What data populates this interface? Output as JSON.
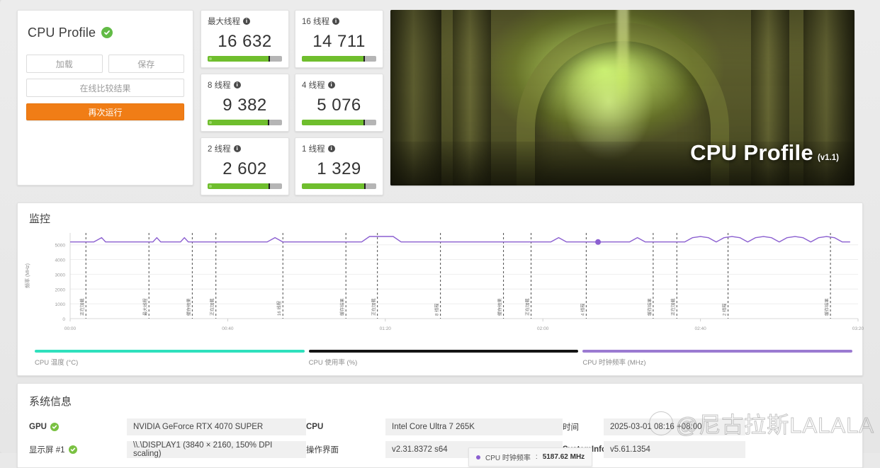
{
  "left_panel": {
    "title": "CPU Profile",
    "verified_icon": "check-badge-icon",
    "load_button": "加载",
    "save_button": "保存",
    "compare_button": "在线比较结果",
    "rerun_button": "再次运行"
  },
  "scores": [
    {
      "label": "最大线程",
      "value": "16 632",
      "fill_pct": 82,
      "tick_pct": 82
    },
    {
      "label": "16 线程",
      "value": "14 711",
      "fill_pct": 83,
      "tick_pct": 83
    },
    {
      "label": "8 线程",
      "value": "9 382",
      "fill_pct": 81,
      "tick_pct": 81
    },
    {
      "label": "4 线程",
      "value": "5 076",
      "fill_pct": 83,
      "tick_pct": 83
    },
    {
      "label": "2 线程",
      "value": "2 602",
      "fill_pct": 82,
      "tick_pct": 82
    },
    {
      "label": "1 线程",
      "value": "1 329",
      "fill_pct": 84,
      "tick_pct": 84
    }
  ],
  "hero": {
    "title": "CPU Profile",
    "version": "(v1.1)"
  },
  "monitoring": {
    "title": "监控",
    "tooltip": {
      "series": "CPU 时钟频率",
      "separator": " : ",
      "value": "5187.62 MHz"
    },
    "legend": [
      {
        "label": "CPU 温度 (°C)",
        "color": "#2fe0bd"
      },
      {
        "label": "CPU 使用率 (%)",
        "color": "#141414"
      },
      {
        "label": "CPU 时钟频率 (MHz)",
        "color": "#9b7ad1"
      }
    ]
  },
  "chart_data": {
    "type": "line",
    "title": "监控",
    "xlabel": "",
    "ylabel": "频率 (MHz)",
    "ylim": [
      0,
      5800
    ],
    "yticks": [
      0,
      1000,
      2000,
      3000,
      4000,
      5000
    ],
    "xlim": [
      0,
      200
    ],
    "xticks": [
      0,
      40,
      80,
      120,
      160,
      200
    ],
    "xtick_labels": [
      "00:00",
      "00:40",
      "01:20",
      "02:00",
      "02:40",
      "03:20"
    ],
    "grid": true,
    "legend_position": "bottom",
    "series": [
      {
        "name": "CPU 时钟频率 (MHz)",
        "color": "#8b5fd0",
        "unit": "MHz",
        "x": [
          0,
          3,
          6,
          8,
          9,
          11,
          13,
          16,
          19,
          21,
          22,
          23,
          25,
          27,
          28,
          29,
          30,
          32,
          34,
          36,
          38,
          39,
          40,
          42,
          44,
          46,
          48,
          50,
          52,
          54,
          56,
          58,
          60,
          62,
          64,
          66,
          68,
          70,
          72,
          74,
          76,
          78,
          80,
          82,
          84,
          86,
          88,
          90,
          92,
          94,
          96,
          98,
          100,
          102,
          104,
          106,
          108,
          110,
          112,
          114,
          116,
          118,
          120,
          122,
          124,
          126,
          128,
          130,
          132,
          134,
          136,
          138,
          140,
          142,
          144,
          146,
          148,
          150,
          152,
          154,
          156,
          158,
          160,
          162,
          164,
          166,
          168,
          170,
          172,
          174,
          176,
          178,
          180,
          182,
          184,
          186,
          188,
          190,
          192,
          194,
          196,
          198
        ],
        "y": [
          5190,
          5190,
          5190,
          5480,
          5190,
          5190,
          5190,
          5190,
          5190,
          5190,
          5480,
          5190,
          5190,
          5190,
          5190,
          5480,
          5190,
          5190,
          5190,
          5190,
          5190,
          5190,
          5190,
          5190,
          5190,
          5190,
          5190,
          5190,
          5480,
          5190,
          5190,
          5190,
          5190,
          5190,
          5190,
          5190,
          5190,
          5190,
          5190,
          5190,
          5560,
          5560,
          5560,
          5560,
          5190,
          5190,
          5190,
          5190,
          5190,
          5190,
          5190,
          5190,
          5190,
          5190,
          5190,
          5190,
          5190,
          5190,
          5190,
          5190,
          5190,
          5190,
          5190,
          5190,
          5480,
          5190,
          5190,
          5190,
          5190,
          5188,
          5190,
          5190,
          5190,
          5190,
          5480,
          5190,
          5190,
          5190,
          5190,
          5190,
          5190,
          5480,
          5560,
          5480,
          5190,
          5480,
          5560,
          5480,
          5190,
          5480,
          5560,
          5480,
          5190,
          5480,
          5560,
          5480,
          5190,
          5480,
          5560,
          5480,
          5190,
          5190
        ]
      }
    ],
    "highlight_point": {
      "x": 134,
      "y": 5187.62,
      "label": "CPU 时钟频率 : 5187.62 MHz"
    },
    "annotations": [
      {
        "x": 4,
        "label": "正在加载"
      },
      {
        "x": 20,
        "label": "最大线程"
      },
      {
        "x": 31,
        "label": "缓存结果"
      },
      {
        "x": 37,
        "label": "正在加载"
      },
      {
        "x": 54,
        "label": "16 线程"
      },
      {
        "x": 70,
        "label": "缓存结果"
      },
      {
        "x": 78,
        "label": "正在加载"
      },
      {
        "x": 94,
        "label": "8 线程"
      },
      {
        "x": 110,
        "label": "缓存结果"
      },
      {
        "x": 117,
        "label": "正在加载"
      },
      {
        "x": 131,
        "label": "4 线程"
      },
      {
        "x": 148,
        "label": "缓存结果"
      },
      {
        "x": 154,
        "label": "正在加载"
      },
      {
        "x": 167,
        "label": "2 线程"
      },
      {
        "x": 193,
        "label": "缓存结果"
      }
    ]
  },
  "system_info": {
    "title": "系统信息",
    "rows": [
      {
        "key": "GPU",
        "key_bold": true,
        "key_check": true,
        "value": "NVIDIA GeForce RTX 4070 SUPER",
        "key2": "CPU",
        "key2_bold": true,
        "value2": "Intel Core Ultra 7 265K",
        "key3": "时间",
        "key3_bold": false,
        "value3": "2025-03-01 08:16 +08:00"
      },
      {
        "key": "显示屏 #1",
        "key_bold": false,
        "key_check": true,
        "value": "\\\\.\\DISPLAY1 (3840 × 2160, 150% DPI scaling)",
        "key2": "操作界面",
        "key2_bold": false,
        "value2": "v2.31.8372 s64",
        "key3": "SystemInfo",
        "key3_bold": true,
        "value3": "v5.61.1354"
      }
    ]
  },
  "watermark": {
    "text": "@尼古拉斯LALALA"
  }
}
